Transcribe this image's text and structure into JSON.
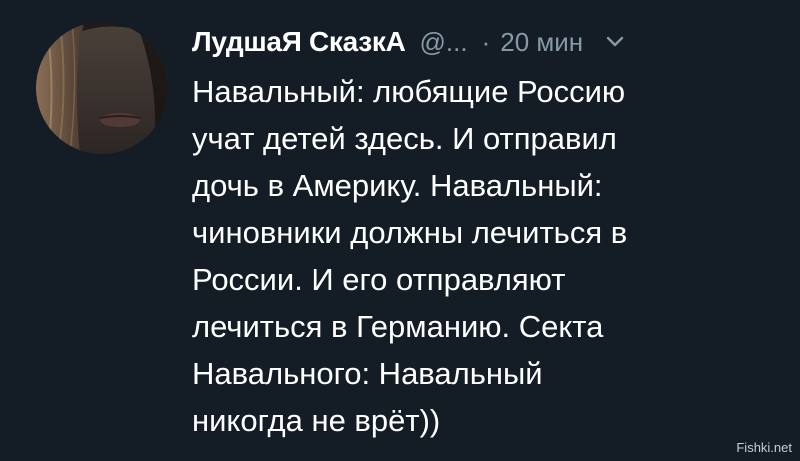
{
  "tweet": {
    "display_name": "ЛудшаЯ СказкА",
    "handle": "@...",
    "separator": "·",
    "time": "20 мин",
    "chevron_icon": "chevron-down-icon",
    "lines": [
      "Навальный: любящие Россию",
      "учат детей здесь. И отправил",
      "дочь в Америку. Навальный:",
      "чиновники должны лечиться в",
      "России. И его отправляют",
      "лечиться в Германию. Секта",
      "Навального: Навальный",
      "никогда не врёт))"
    ]
  },
  "watermark": "Fishki.net",
  "colors": {
    "background": "#141d26",
    "text": "#ffffff",
    "secondary": "#8899a6"
  }
}
